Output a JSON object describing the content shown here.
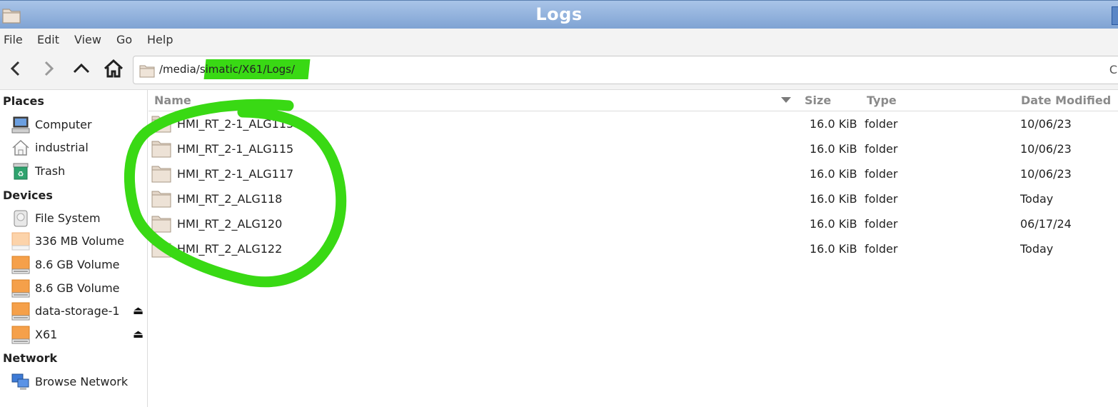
{
  "window": {
    "title": "Logs"
  },
  "menu": {
    "items": [
      "File",
      "Edit",
      "View",
      "Go",
      "Help"
    ]
  },
  "location": {
    "path": "/media/simatic/X61/Logs/"
  },
  "sidebar": {
    "places_heading": "Places",
    "places": [
      {
        "label": "Computer",
        "icon": "computer-icon"
      },
      {
        "label": "industrial",
        "icon": "home-folder-icon"
      },
      {
        "label": "Trash",
        "icon": "trash-icon"
      }
    ],
    "devices_heading": "Devices",
    "devices": [
      {
        "label": "File System",
        "icon": "harddisk-icon"
      },
      {
        "label": "336 MB Volume",
        "icon": "volume-icon"
      },
      {
        "label": "8.6 GB Volume",
        "icon": "volume-icon"
      },
      {
        "label": "8.6 GB Volume",
        "icon": "volume-icon"
      },
      {
        "label": "data-storage-1",
        "icon": "volume-icon",
        "eject": true
      },
      {
        "label": "X61",
        "icon": "volume-icon",
        "eject": true
      }
    ],
    "network_heading": "Network",
    "network": [
      {
        "label": "Browse Network",
        "icon": "network-icon"
      }
    ]
  },
  "table": {
    "columns": [
      "Name",
      "Size",
      "Type",
      "Date Modified"
    ],
    "rows": [
      {
        "name": "HMI_RT_2-1_ALG113",
        "size": "16.0 KiB",
        "type": "folder",
        "modified": "10/06/23"
      },
      {
        "name": "HMI_RT_2-1_ALG115",
        "size": "16.0 KiB",
        "type": "folder",
        "modified": "10/06/23"
      },
      {
        "name": "HMI_RT_2-1_ALG117",
        "size": "16.0 KiB",
        "type": "folder",
        "modified": "10/06/23"
      },
      {
        "name": "HMI_RT_2_ALG118",
        "size": "16.0 KiB",
        "type": "folder",
        "modified": "Today"
      },
      {
        "name": "HMI_RT_2_ALG120",
        "size": "16.0 KiB",
        "type": "folder",
        "modified": "06/17/24"
      },
      {
        "name": "HMI_RT_2_ALG122",
        "size": "16.0 KiB",
        "type": "folder",
        "modified": "Today"
      }
    ]
  },
  "colors": {
    "titlebar": "#7fa3d3",
    "annotation_green": "#39d914",
    "volume_orange": "#f5a04a"
  }
}
